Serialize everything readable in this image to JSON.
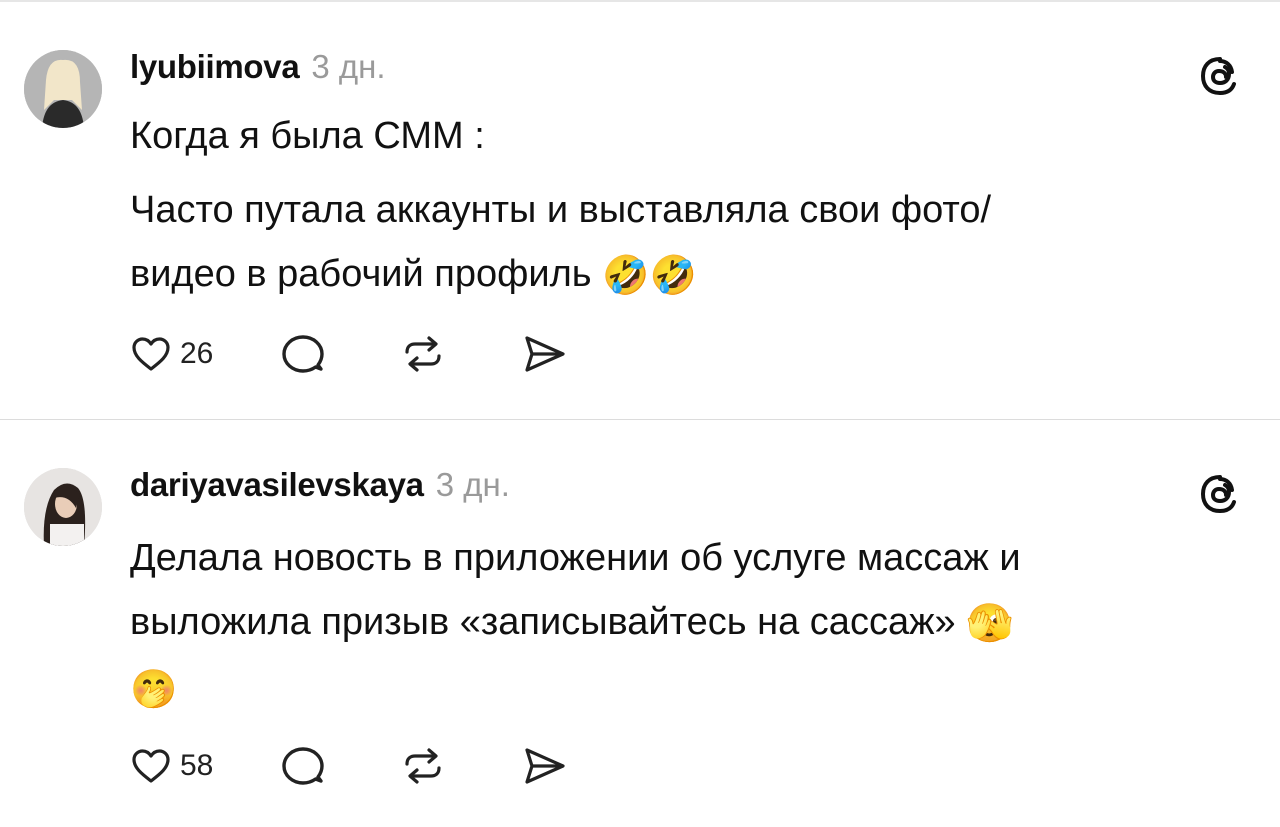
{
  "posts": [
    {
      "username": "lyubiimova",
      "time": "3 дн.",
      "text_lines": [
        "Когда я была СММ :",
        "Часто путала аккаунты и выставляла свои фото/",
        "видео в рабочий профиль"
      ],
      "text_emojis": "🤣🤣",
      "likes": "26",
      "icons": [
        "heart-icon",
        "comment-icon",
        "repost-icon",
        "share-icon",
        "threads-icon"
      ]
    },
    {
      "username": "dariyavasilevskaya",
      "time": "3 дн.",
      "text_lines": [
        "Делала новость в приложении об услуге массаж и",
        "выложила призыв «записывайтесь на сассаж»"
      ],
      "text_emojis": "🫣",
      "text_trailing_emoji": "🤭",
      "likes": "58",
      "icons": [
        "heart-icon",
        "comment-icon",
        "repost-icon",
        "share-icon",
        "threads-icon"
      ]
    }
  ],
  "colors": {
    "text": "#111111",
    "muted": "#9a9a9a",
    "divider": "#dcdcdc",
    "background": "#ffffff"
  }
}
